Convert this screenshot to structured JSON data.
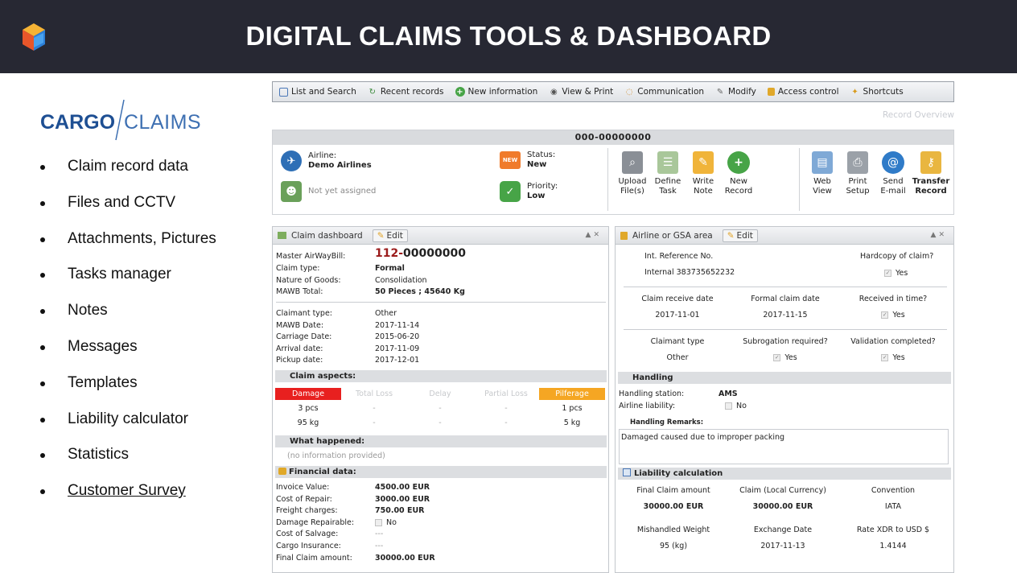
{
  "banner": {
    "title": "DIGITAL CLAIMS TOOLS & DASHBOARD"
  },
  "brand": {
    "part1": "CARGO",
    "part2": "CLAIMS"
  },
  "features": [
    "Claim record data",
    "Files and CCTV",
    "Attachments, Pictures",
    "Tasks manager",
    "Notes",
    "Messages",
    "Templates",
    "Liability calculator",
    "Statistics",
    "Customer Survey"
  ],
  "menubar": {
    "list_search": "List and Search",
    "recent": "Recent records",
    "new_info": "New information",
    "view_print": "View & Print",
    "communication": "Communication",
    "modify": "Modify",
    "access": "Access control",
    "shortcuts": "Shortcuts"
  },
  "record_overview": "Record Overview",
  "header": {
    "record_id": "000-00000000",
    "airline_label": "Airline:",
    "airline_value": "Demo Airlines",
    "assignee": "Not yet assigned",
    "status_label": "Status:",
    "status_value": "New",
    "priority_label": "Priority:",
    "priority_value": "Low",
    "new_badge": "NEW",
    "actions": [
      {
        "l1": "Upload",
        "l2": "File(s)"
      },
      {
        "l1": "Define",
        "l2": "Task"
      },
      {
        "l1": "Write",
        "l2": "Note"
      },
      {
        "l1": "New",
        "l2": "Record"
      },
      {
        "l1": "Web",
        "l2": "View"
      },
      {
        "l1": "Print",
        "l2": "Setup"
      },
      {
        "l1": "Send",
        "l2": "E-mail"
      },
      {
        "l1": "Transfer",
        "l2": "Record"
      }
    ]
  },
  "left_panel": {
    "title": "Claim dashboard",
    "edit": "Edit",
    "mawb_label": "Master AirWayBill:",
    "mawb_prefix": "112-",
    "mawb_number": "00000000",
    "claim_type_label": "Claim type:",
    "claim_type": "Formal",
    "nature_label": "Nature of Goods:",
    "nature": "Consolidation",
    "total_label": "MAWB Total:",
    "total_pieces": "50 Pieces ;",
    "total_kg": "45640 Kg",
    "claimant_label": "Claimant type:",
    "claimant": "Other",
    "mawb_date_label": "MAWB Date:",
    "mawb_date": "2017-11-14",
    "carriage_label": "Carriage Date:",
    "carriage": "2015-06-20",
    "arrival_label": "Arrival date:",
    "arrival": "2017-11-09",
    "pickup_label": "Pickup date:",
    "pickup": "2017-12-01",
    "aspects_title": "Claim aspects:",
    "aspects": [
      "Damage",
      "Total Loss",
      "Delay",
      "Partial Loss",
      "Pilferage"
    ],
    "aspect_row1": [
      "3 pcs",
      "-",
      "-",
      "-",
      "1 pcs"
    ],
    "aspect_row2": [
      "95 kg",
      "-",
      "-",
      "-",
      "5 kg"
    ],
    "what_title": "What happened:",
    "what_text": "(no information provided)",
    "fin_title": "Financial data:",
    "invoice_label": "Invoice Value:",
    "invoice": "4500.00 EUR",
    "repair_label": "Cost of Repair:",
    "repair": "3000.00 EUR",
    "freight_label": "Freight charges:",
    "freight": "750.00 EUR",
    "repairable_label": "Damage Repairable:",
    "repairable": "No",
    "salvage_label": "Cost of Salvage:",
    "salvage": "---",
    "insurance_label": "Cargo Insurance:",
    "insurance": "---",
    "final_label": "Final Claim amount:",
    "final": "30000.00 EUR"
  },
  "right_panel": {
    "title": "Airline or GSA area",
    "edit": "Edit",
    "int_ref_label": "Int. Reference No.",
    "int_ref": "Internal 383735652232",
    "hardcopy_label": "Hardcopy of claim?",
    "yes": "Yes",
    "no": "No",
    "receive_label": "Claim receive date",
    "receive": "2017-11-01",
    "formal_label": "Formal claim date",
    "formal": "2017-11-15",
    "intime_label": "Received in time?",
    "claimant_label": "Claimant type",
    "claimant": "Other",
    "subrogation_label": "Subrogation required?",
    "validation_label": "Validation completed?",
    "handling_title": "Handling",
    "station_label": "Handling station:",
    "station": "AMS",
    "liability_label": "Airline liability:",
    "remarks_label": "Handling Remarks:",
    "remarks": "Damaged caused due to improper packing",
    "liab_title": "Liability calculation",
    "final_label": "Final Claim amount",
    "final": "30000.00 EUR",
    "local_label": "Claim (Local Currency)",
    "local": "30000.00 EUR",
    "convention_label": "Convention",
    "convention": "IATA",
    "weight_label": "Mishandled Weight",
    "weight": "95 (kg)",
    "exch_label": "Exchange Date",
    "exch": "2017-11-13",
    "rate_label": "Rate XDR to USD $",
    "rate": "1.4144"
  },
  "colors": {
    "banner": "#272833",
    "brand_dark": "#1e4f93",
    "brand_light": "#3e70b2",
    "damage": "#e8201f",
    "pilferage": "#f5a623",
    "mawb_red": "#9b1b1b"
  }
}
